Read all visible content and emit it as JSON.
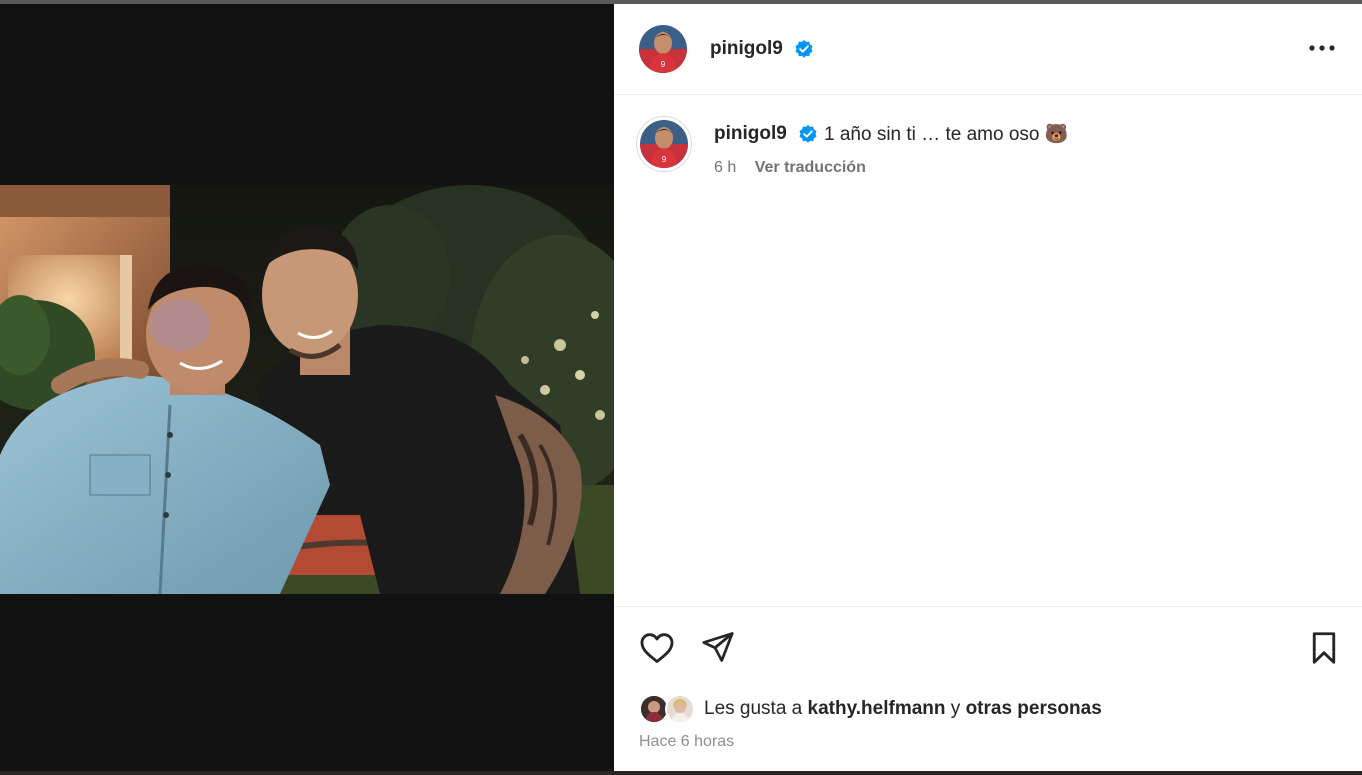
{
  "post": {
    "username": "pinigol9",
    "verified": true,
    "caption": "1 año sin ti … te amo oso 🐻",
    "relative_time": "6 h",
    "translate_label": "Ver traducción",
    "likes": {
      "prefix": "Les gusta a",
      "user": "kathy.helfmann",
      "joiner": "y",
      "others": "otras personas"
    },
    "timestamp": "Hace 6 horas"
  },
  "icons": {
    "more": "more-horizontal-icon",
    "like": "heart-outline-icon",
    "share": "paper-plane-icon",
    "save": "bookmark-outline-icon",
    "verified": "verified-badge-icon"
  },
  "colors": {
    "verified_blue": "#0095f6",
    "text_primary": "#262626",
    "text_secondary": "#737373",
    "media_background": "#111111"
  }
}
